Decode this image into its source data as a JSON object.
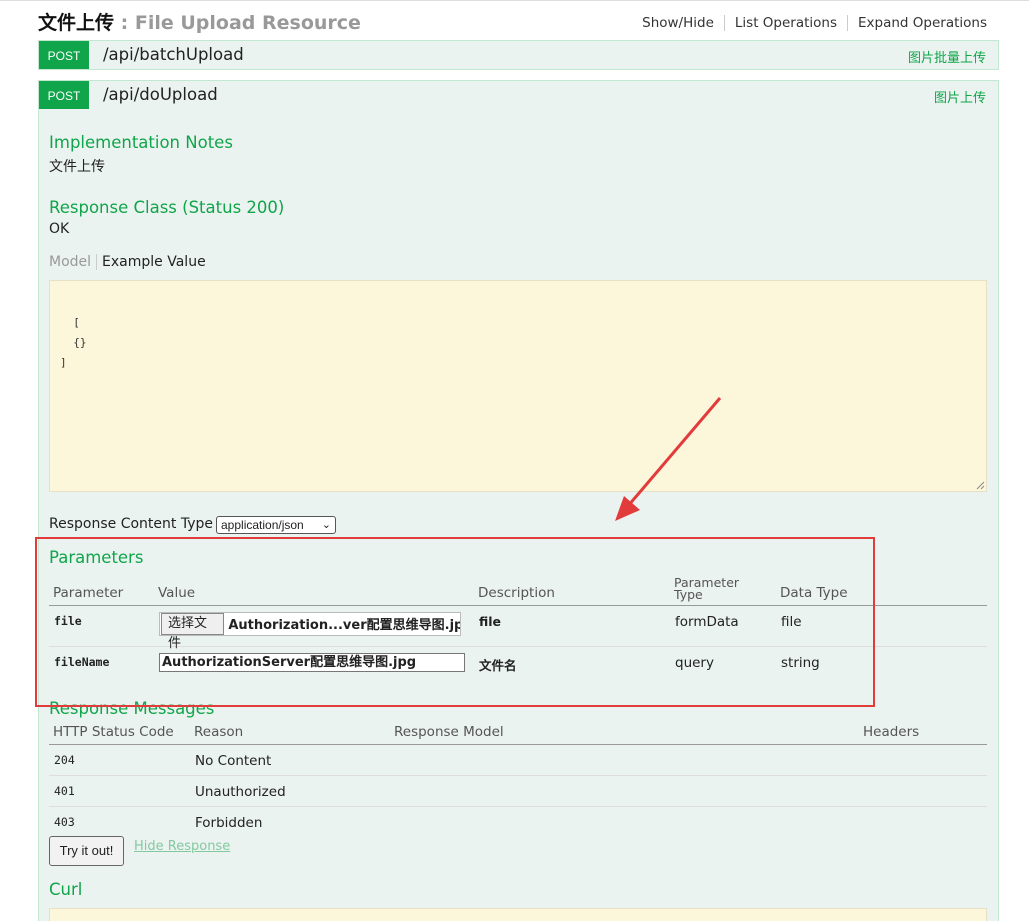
{
  "resource": {
    "title_zh": "文件上传",
    "title_en": ": File Upload Resource",
    "links": [
      "Show/Hide",
      "List Operations",
      "Expand Operations"
    ]
  },
  "operations": [
    {
      "method": "POST",
      "path": "/api/batchUpload",
      "summary": "图片批量上传"
    },
    {
      "method": "POST",
      "path": "/api/doUpload",
      "summary": "图片上传"
    }
  ],
  "details": {
    "impl_notes_heading": "Implementation Notes",
    "impl_notes_text": "文件上传",
    "response_class_heading": "Response Class (Status 200)",
    "response_class_text": "OK",
    "model_tab": "Model",
    "example_tab": "Example Value",
    "example_value": "[\n  {}\n]",
    "response_content_type_label": "Response Content Type",
    "response_content_type_value": "application/json"
  },
  "parameters": {
    "heading": "Parameters",
    "columns": [
      "Parameter",
      "Value",
      "Description",
      "Parameter Type",
      "Data Type"
    ],
    "column_param_type_line1": "Parameter",
    "column_param_type_line2": "Type",
    "rows": [
      {
        "name": "file",
        "button": "选择文件",
        "value": "Authorization...ver配置思维导图.jpg",
        "description": "file",
        "param_type": "formData",
        "data_type": "file"
      },
      {
        "name": "fileName",
        "value": "AuthorizationServer配置思维导图.jpg",
        "description": "文件名",
        "param_type": "query",
        "data_type": "string"
      }
    ]
  },
  "response_messages": {
    "heading": "Response Messages",
    "columns": [
      "HTTP Status Code",
      "Reason",
      "Response Model",
      "Headers"
    ],
    "rows": [
      {
        "code": "204",
        "reason": "No Content"
      },
      {
        "code": "401",
        "reason": "Unauthorized"
      },
      {
        "code": "403",
        "reason": "Forbidden"
      }
    ]
  },
  "actions": {
    "try_it_out": "Try it out!",
    "hide_response": "Hide Response"
  },
  "curl": {
    "heading": "Curl"
  },
  "colors": {
    "post_green": "#10a54a",
    "op_bg": "#ebf3f0",
    "snippet_bg": "#fcf6db",
    "annotation_red": "#e23b3b"
  }
}
